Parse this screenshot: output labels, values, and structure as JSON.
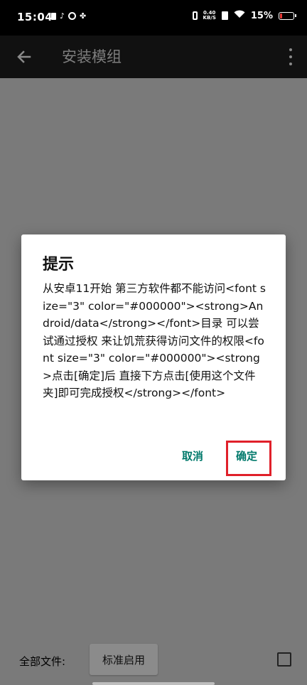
{
  "status_bar": {
    "time": "15:04",
    "net_speed_value": "0.40",
    "net_speed_unit": "KB/S",
    "battery": "15%"
  },
  "toolbar": {
    "title": "安装模组",
    "back_icon": "arrow-back-icon",
    "more_icon": "more-vert-icon"
  },
  "dialog": {
    "title": "提示",
    "message": "从安卓11开始 第三方软件都不能访问<font size=\"3\" color=\"#000000\"><strong>Android/data</strong></font>目录 可以尝试通过授权 来让饥荒获得访问文件的权限<font size=\"3\" color=\"#000000\"><strong>点击[确定]后 直接下方点击[使用这个文件夹]即可完成授权</strong></font>",
    "cancel_label": "取消",
    "ok_label": "确定"
  },
  "bottom": {
    "all_files_label": "全部文件:",
    "standard_enable_label": "标准启用"
  },
  "colors": {
    "accent": "#00796b",
    "highlight": "#e0202a",
    "battery_low": "#e53935"
  }
}
